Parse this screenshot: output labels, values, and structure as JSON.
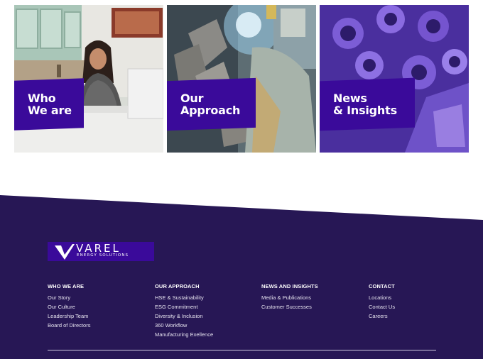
{
  "cards": [
    {
      "label": "Who\nWe are",
      "image": "office-person-photo"
    },
    {
      "label": "Our\nApproach",
      "image": "welding-drill-bit-photo"
    },
    {
      "label": "News\n& Insights",
      "image": "purple-drill-bit-photo"
    }
  ],
  "footer": {
    "logo": {
      "name": "VAREL",
      "tagline": "ENERGY SOLUTIONS"
    },
    "columns": [
      {
        "title": "WHO WE ARE",
        "links": [
          "Our Story",
          "Our Culture",
          "Leadership Team",
          "Board of Directors"
        ]
      },
      {
        "title": "OUR APPROACH",
        "links": [
          "HSE & Sustainability",
          "ESG Commitment",
          "Diversity & Inclusion",
          "360 Workflow",
          "Manufacturing Exellence"
        ]
      },
      {
        "title": "NEWS AND INSIGHTS",
        "links": [
          "Media & Publications",
          "Customer Successes"
        ]
      },
      {
        "title": "CONTACT",
        "links": [
          "Locations",
          "Contact Us",
          "Careers"
        ]
      }
    ]
  },
  "colors": {
    "brand_purple": "#3a0a9a",
    "footer_bg": "#271755"
  }
}
